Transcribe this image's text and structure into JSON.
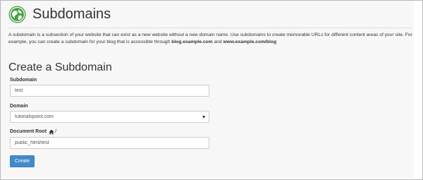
{
  "header": {
    "title": "Subdomains",
    "icon": "subdomains-globe-icon"
  },
  "description": {
    "text_1": "A subdomain is a subsection of your website that can exist as a new website without a new domain name. Use subdomains to create memorable URLs for different content areas of your site. For example, you can create a subdomain for your blog that is accessible through ",
    "example_1": "blog.example.com",
    "text_2": " and ",
    "example_2": "www.example.com/blog"
  },
  "form": {
    "title": "Create a Subdomain",
    "subdomain_label": "Subdomain",
    "subdomain_value": "test",
    "domain_label": "Domain",
    "domain_selected": "tutorialspoint.com",
    "document_root_label": "Document Root",
    "document_root_icon": "home-icon",
    "document_root_suffix": "/",
    "document_root_value": "public_html/test",
    "submit_label": "Create"
  },
  "colors": {
    "accent": "#428bca",
    "icon_green": "#4aa142",
    "background": "#f7f7f7"
  }
}
